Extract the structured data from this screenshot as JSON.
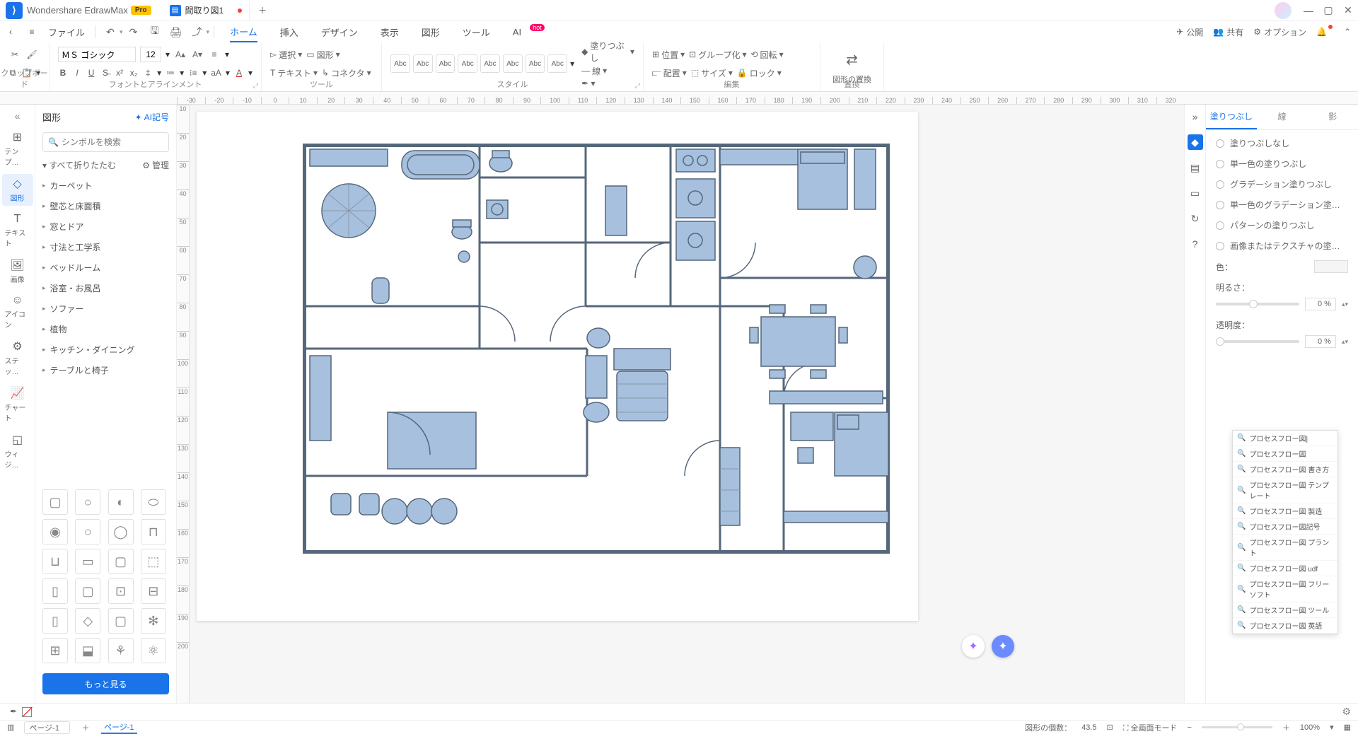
{
  "app": {
    "name": "Wondershare EdrawMax",
    "badge": "Pro",
    "document_tab": "間取り図1"
  },
  "menus": {
    "file": "ファイル",
    "tabs": [
      "ホーム",
      "挿入",
      "デザイン",
      "表示",
      "図形",
      "ツール",
      "AI"
    ],
    "active_tab": "ホーム",
    "hot_badge": "hot"
  },
  "toolbar_right": {
    "publish": "公開",
    "share": "共有",
    "options": "オプション"
  },
  "ribbon": {
    "clipboard": "クリップボード",
    "font_align": "フォントとアラインメント",
    "tools": "ツール",
    "style": "スタイル",
    "edit": "編集",
    "replace": "置換",
    "font_name": "ＭＳ ゴシック",
    "font_size": "12",
    "select": "選択",
    "shape": "図形",
    "text": "テキスト",
    "connector": "コネクタ",
    "fill": "塗りつぶし",
    "line": "線",
    "position": "位置",
    "align": "配置",
    "group": "グループ化",
    "size": "サイズ",
    "rotate": "回転",
    "lock": "ロック",
    "shape_replace": "図形の置換",
    "style_label": "Abc"
  },
  "left_rail": {
    "template": "テンプ…",
    "shapes": "図形",
    "text": "テキスト",
    "image": "画像",
    "icon": "アイコン",
    "stencil": "ステッ…",
    "chart": "チャート",
    "widget": "ウィジ…"
  },
  "shapes_panel": {
    "title": "図形",
    "ai": "AI記号",
    "search_placeholder": "シンボルを検索",
    "collapse_all": "すべて折りたたむ",
    "manage": "管理",
    "categories": [
      "カーペット",
      "壁芯と床面積",
      "窓とドア",
      "寸法と工学系",
      "ベッドルーム",
      "浴室・お風呂",
      "ソファー",
      "植物",
      "キッチン・ダイニング",
      "テーブルと椅子"
    ],
    "more": "もっと見る"
  },
  "ruler_h": [
    "-30",
    "-20",
    "-10",
    "0",
    "10",
    "20",
    "30",
    "40",
    "50",
    "60",
    "70",
    "80",
    "90",
    "100",
    "110",
    "120",
    "130",
    "140",
    "150",
    "160",
    "170",
    "180",
    "190",
    "200",
    "210",
    "220",
    "230",
    "240",
    "250",
    "260",
    "270",
    "280",
    "290",
    "300",
    "310",
    "320"
  ],
  "ruler_v": [
    "10",
    "20",
    "30",
    "40",
    "50",
    "60",
    "70",
    "80",
    "90",
    "100",
    "110",
    "120",
    "130",
    "140",
    "150",
    "160",
    "170",
    "180",
    "190",
    "200"
  ],
  "right_panel": {
    "tabs": {
      "fill": "塗りつぶし",
      "line": "線",
      "shadow": "影"
    },
    "options": {
      "no_fill": "塗りつぶしなし",
      "solid": "単一色の塗りつぶし",
      "gradient": "グラデーション塗りつぶし",
      "solid_gradient": "単一色のグラデーション塗…",
      "pattern": "パターンの塗りつぶし",
      "image_texture": "画像またはテクスチャの塗…"
    },
    "color_label": "色：",
    "brightness_label": "明るさ：",
    "opacity_label": "透明度：",
    "brightness_value": "0 %",
    "opacity_value": "0 %"
  },
  "suggestions": [
    "プロセスフロー図|",
    "プロセスフロー図",
    "プロセスフロー図 書き方",
    "プロセスフロー図 テンプレート",
    "プロセスフロー図 製造",
    "プロセスフロー図記号",
    "プロセスフロー図 プラント",
    "プロセスフロー図 udf",
    "プロセスフロー図 フリーソフト",
    "プロセスフロー図 ツール",
    "プロセスフロー図 英語"
  ],
  "statusbar": {
    "page_select": "ページ-1",
    "page_tab": "ページ-1",
    "shape_count_label": "図形の個数：",
    "shape_count": "43.5",
    "fullscreen": "全画面モード",
    "zoom": "100%"
  }
}
